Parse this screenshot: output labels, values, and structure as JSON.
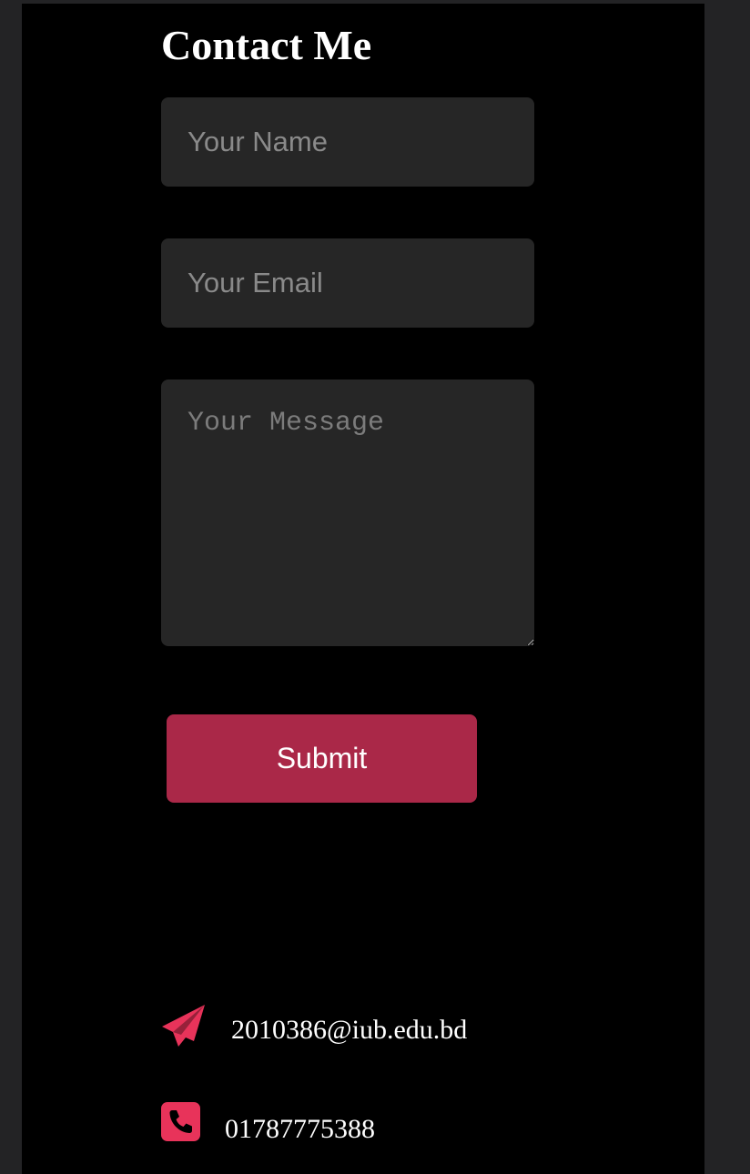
{
  "contact": {
    "title": "Contact Me",
    "form": {
      "name_placeholder": "Your Name",
      "email_placeholder": "Your Email",
      "message_placeholder": "Your Message",
      "submit_label": "Submit"
    },
    "info": {
      "email": "2010386@iub.edu.bd",
      "email_icon": "paper-plane-icon",
      "phone": "01787775388",
      "phone_icon": "phone-square-icon"
    }
  },
  "colors": {
    "page_background": "#000000",
    "outer_background": "#232325",
    "field_background": "#262626",
    "accent": "#aa2848",
    "icon_accent": "#e8335a"
  }
}
